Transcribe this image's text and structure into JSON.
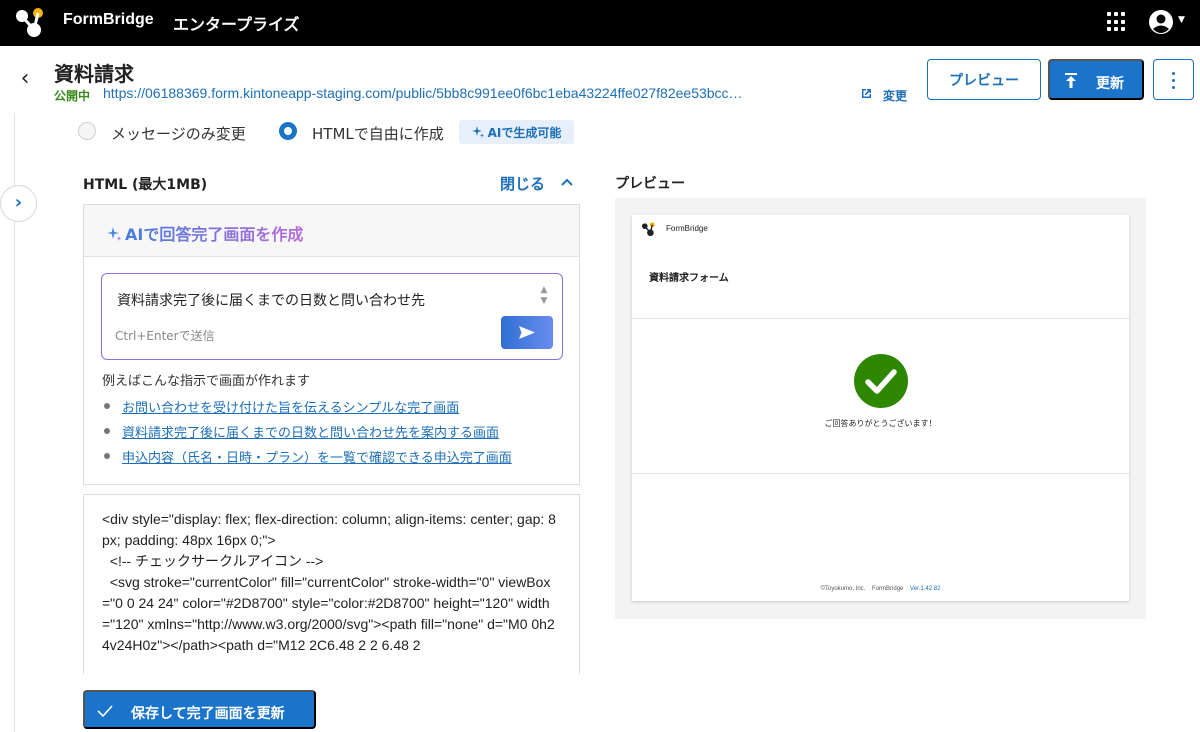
{
  "topbar": {
    "brand": "FormBridge",
    "edition": "エンタープライズ",
    "icons": [
      "apps-grid-icon",
      "account-icon",
      "chevron-down-icon"
    ]
  },
  "header": {
    "title": "資料請求",
    "status": "公開中",
    "url": "https://06188369.form.kintoneapp-staging.com/public/5bb8c991ee0f6bc1eba43224ffe027f82ee53bcc…",
    "change_label": "変更",
    "preview_label": "プレビュー",
    "update_label": "更新"
  },
  "mode": {
    "option_message": "メッセージのみ変更",
    "option_html": "HTMLで自由に作成",
    "ai_badge": "AIで生成可能",
    "selected": "HTMLで自由に作成"
  },
  "editor": {
    "heading": "HTML (最大1MB)",
    "close_label": "閉じる",
    "ai_title": "AIで回答完了画面を作成",
    "prompt_value": "資料請求完了後に届くまでの日数と問い合わせ先",
    "prompt_hint": "Ctrl+Enterで送信",
    "examples_label": "例えばこんな指示で画面が作れます",
    "examples": [
      "お問い合わせを受け付けた旨を伝えるシンプルな完了画面",
      "資料請求完了後に届くまでの日数と問い合わせ先を案内する画面",
      "申込内容（氏名・日時・プラン）を一覧で確認できる申込完了画面"
    ],
    "code": "<div style=\"display: flex; flex-direction: column; align-items: center; gap: 8px; padding: 48px 16px 0;\">\n  <!-- チェックサークルアイコン -->\n  <svg stroke=\"currentColor\" fill=\"currentColor\" stroke-width=\"0\" viewBox=\"0 0 24 24\" color=\"#2D8700\" style=\"color:#2D8700\" height=\"120\" width=\"120\" xmlns=\"http://www.w3.org/2000/svg\"><path fill=\"none\" d=\"M0 0h24v24H0z\"></path><path d=\"M12 2C6.48 2 2 6.48 2",
    "save_label": "保存して完了画面を更新"
  },
  "preview": {
    "heading": "プレビュー",
    "brand": "FormBridge",
    "form_title": "資料請求フォーム",
    "thanks": "ご回答ありがとうございます！",
    "footer_company": "©Toyokumo, Inc.",
    "footer_brand": "FormBridge",
    "footer_version": "Ver.1.42.82",
    "check_color": "#2D8700"
  },
  "colors": {
    "accent": "#1b74c9",
    "success": "#2D8700",
    "ai_gradient_start": "#3a7fe0",
    "ai_gradient_end": "#b86bd8"
  }
}
